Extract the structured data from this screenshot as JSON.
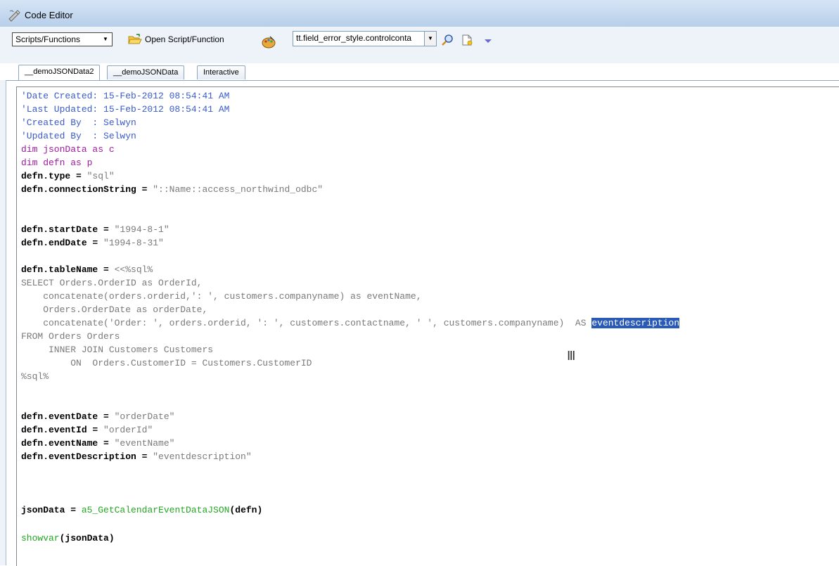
{
  "window": {
    "title": "Code Editor"
  },
  "toolbar": {
    "scripts_select": "Scripts/Functions",
    "open_label": "Open Script/Function",
    "field_select": "tt.field_error_style.controlconta"
  },
  "tabs": [
    {
      "label": "__demoJSONData2",
      "active": true
    },
    {
      "label": "__demoJSONData",
      "active": false
    },
    {
      "label": "Interactive",
      "active": false
    }
  ],
  "code": {
    "l1": "'Date Created: 15-Feb-2012 08:54:41 AM",
    "l2": "'Last Updated: 15-Feb-2012 08:54:41 AM",
    "l3": "'Created By  : Selwyn",
    "l4": "'Updated By  : Selwyn",
    "l5": "dim jsonData as c",
    "l6": "dim defn as p",
    "l7a": "defn.type = ",
    "l7b": "\"sql\"",
    "l8a": "defn.connectionString = ",
    "l8b": "\"::Name::access_northwind_odbc\"",
    "l9a": "defn.startDate = ",
    "l9b": "\"1994-8-1\"",
    "l10a": "defn.endDate = ",
    "l10b": "\"1994-8-31\"",
    "l11a": "defn.tableName = ",
    "l11b": "<<%sql%",
    "l12": "SELECT Orders.OrderID as OrderId,",
    "l13": "    concatenate(orders.orderid,': ', customers.companyname) as eventName,",
    "l14": "    Orders.OrderDate as orderDate,",
    "l15a": "    concatenate('Order: ', orders.orderid, ': ', customers.contactname, ' ', customers.companyname)  AS ",
    "l15b": "eventdescription",
    "l16": "FROM Orders Orders",
    "l17": "     INNER JOIN Customers Customers",
    "l18": "         ON  Orders.CustomerID = Customers.CustomerID",
    "l19": "%sql%",
    "l20a": "defn.eventDate = ",
    "l20b": "\"orderDate\"",
    "l21a": "defn.eventId = ",
    "l21b": "\"orderId\"",
    "l22a": "defn.eventName = ",
    "l22b": "\"eventName\"",
    "l23a": "defn.eventDescription = ",
    "l23b": "\"eventdescription\"",
    "l24a": "jsonData = ",
    "l24b": "a5_GetCalendarEventDataJSON",
    "l24c": "(defn)",
    "l25a": "showvar",
    "l25b": "(jsonData)"
  },
  "colors": {
    "comment": "#3a5bcc",
    "dim": "#a01aa0",
    "string": "#7a7a7a",
    "function": "#22a822",
    "selection": "#2a5ab8"
  }
}
